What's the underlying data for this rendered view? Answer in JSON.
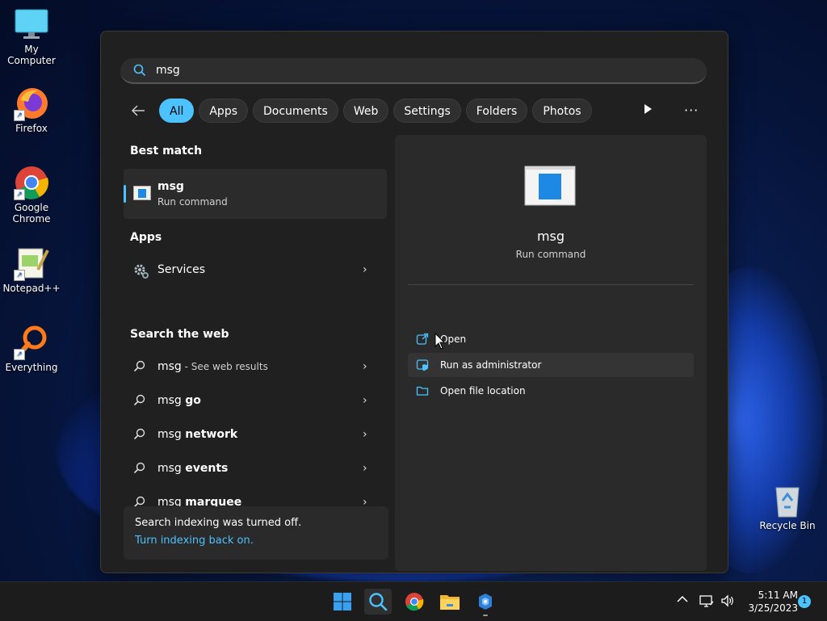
{
  "desktop": {
    "icons": [
      {
        "label": "My Computer",
        "icon": "monitor-icon"
      },
      {
        "label": "Firefox",
        "icon": "firefox-icon"
      },
      {
        "label": "Google Chrome",
        "icon": "chrome-icon"
      },
      {
        "label": "Notepad++",
        "icon": "notepadpp-icon"
      },
      {
        "label": "Everything",
        "icon": "everything-icon"
      },
      {
        "label": "Recycle Bin",
        "icon": "recycle-bin-icon"
      }
    ]
  },
  "search": {
    "query": "msg",
    "filters": [
      "All",
      "Apps",
      "Documents",
      "Web",
      "Settings",
      "Folders",
      "Photos"
    ],
    "active_filter": "All"
  },
  "results": {
    "best_match_title": "Best match",
    "best_match": {
      "name": "msg",
      "type": "Run command"
    },
    "apps_title": "Apps",
    "apps": [
      {
        "label": "Services"
      }
    ],
    "web_title": "Search the web",
    "web": [
      {
        "prefix": "msg",
        "suffix": " - See web results",
        "bold": false
      },
      {
        "prefix": "msg ",
        "suffix": "go",
        "bold": true
      },
      {
        "prefix": "msg ",
        "suffix": "network",
        "bold": true
      },
      {
        "prefix": "msg ",
        "suffix": "events",
        "bold": true
      },
      {
        "prefix": "msg ",
        "suffix": "marquee",
        "bold": true
      }
    ],
    "indexing_notice": "Search indexing was turned off.",
    "indexing_link": "Turn indexing back on."
  },
  "detail": {
    "name": "msg",
    "type": "Run command",
    "actions": [
      {
        "label": "Open",
        "icon": "open-external-icon"
      },
      {
        "label": "Run as administrator",
        "icon": "shield-icon"
      },
      {
        "label": "Open file location",
        "icon": "folder-icon"
      }
    ]
  },
  "taskbar": {
    "apps": [
      "start-icon",
      "search-icon",
      "chrome-icon",
      "file-explorer-icon",
      "app-icon"
    ],
    "time": "5:11 AM",
    "date": "3/25/2023",
    "notifications": "1"
  },
  "colors": {
    "accent": "#4cc2ff",
    "panel": "#202020"
  }
}
